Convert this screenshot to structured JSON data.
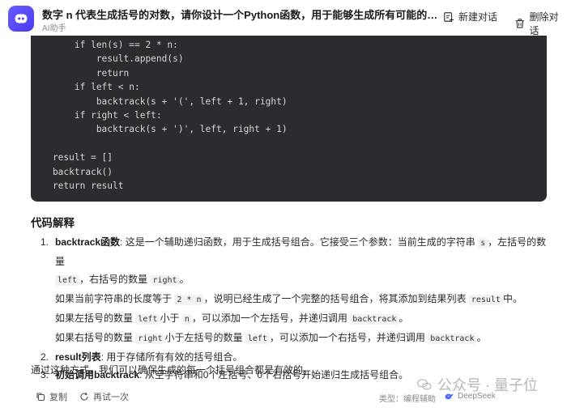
{
  "header": {
    "title": "数字 n 代表生成括号的对数，请你设计一个Python函数，用于能够生成所有可能的并且 ...",
    "subtitle": "AI助手",
    "new_chat_label": "新建对话",
    "delete_chat_label": "删除对话"
  },
  "code": {
    "lines": [
      "        if len(s) == 2 * n:",
      "            result.append(s)",
      "            return",
      "        if left < n:",
      "            backtrack(s + '(', left + 1, right)",
      "        if right < left:",
      "            backtrack(s + ')', left, right + 1)",
      "",
      "    result = []",
      "    backtrack()",
      "    return result"
    ]
  },
  "explanation": {
    "title": "代码解释",
    "item1": {
      "num": "1.",
      "term": "backtrack函数",
      "text_a": ": 这是一个辅助递归函数，用于生成括号组合。它接受三个参数：当前生成的字符串",
      "code_s": "s",
      "text_b": "，左括号的数量",
      "code_left": "left",
      "text_c": "，右括号的数量",
      "code_right": "right",
      "text_d": "。",
      "sub1_a": "如果当前字符串的长度等于",
      "sub1_code": "2 * n",
      "sub1_b": "，说明已经生成了一个完整的括号组合，将其添加到结果列表",
      "sub1_code2": "result",
      "sub1_c": "中。",
      "sub2_a": "如果左括号的数量",
      "sub2_code": "left",
      "sub2_b": "小于",
      "sub2_code2": "n",
      "sub2_c": "，可以添加一个左括号，并递归调用",
      "sub2_code3": "backtrack",
      "sub2_d": "。",
      "sub3_a": "如果右括号的数量",
      "sub3_code": "right",
      "sub3_b": "小于左括号的数量",
      "sub3_code2": "left",
      "sub3_c": "，可以添加一个右括号，并递归调用",
      "sub3_code3": "backtrack",
      "sub3_d": "。"
    },
    "item2": {
      "num": "2.",
      "term": "result列表",
      "text": ": 用于存储所有有效的括号组合。"
    },
    "item3": {
      "num": "3.",
      "term": "初始调用backtrack",
      "text": ": 从空字符串和0个左括号、0个右括号开始递归生成括号组合。"
    },
    "conclusion": "通过这种方式，我们可以确保生成的每一个括号组合都是有效的。"
  },
  "footer": {
    "copy_label": "复制",
    "retry_label": "再试一次",
    "category": "类型：编程辅助",
    "model": "DeepSeek",
    "watermark": "公众号 · 量子位"
  }
}
